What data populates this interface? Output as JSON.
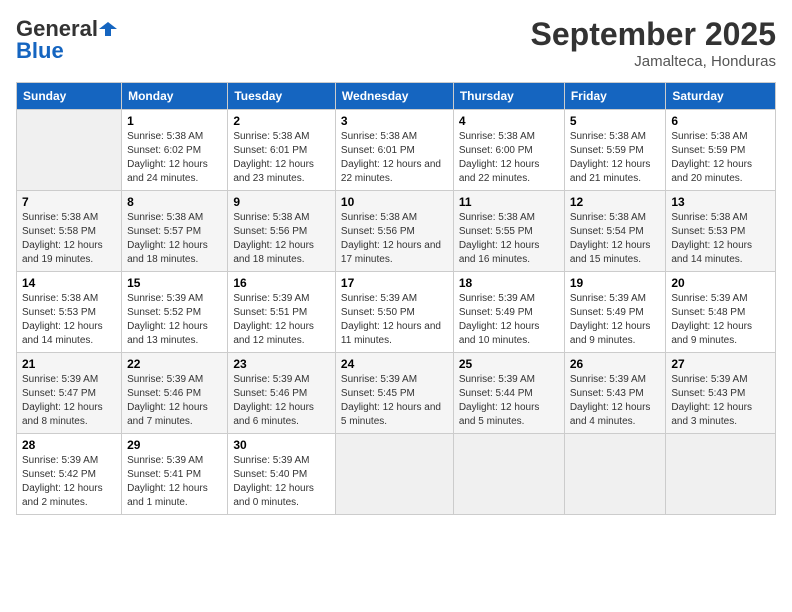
{
  "header": {
    "logo_general": "General",
    "logo_blue": "Blue",
    "month": "September 2025",
    "location": "Jamalteca, Honduras"
  },
  "days_of_week": [
    "Sunday",
    "Monday",
    "Tuesday",
    "Wednesday",
    "Thursday",
    "Friday",
    "Saturday"
  ],
  "weeks": [
    [
      {
        "day": "",
        "sunrise": "",
        "sunset": "",
        "daylight": ""
      },
      {
        "day": "1",
        "sunrise": "Sunrise: 5:38 AM",
        "sunset": "Sunset: 6:02 PM",
        "daylight": "Daylight: 12 hours and 24 minutes."
      },
      {
        "day": "2",
        "sunrise": "Sunrise: 5:38 AM",
        "sunset": "Sunset: 6:01 PM",
        "daylight": "Daylight: 12 hours and 23 minutes."
      },
      {
        "day": "3",
        "sunrise": "Sunrise: 5:38 AM",
        "sunset": "Sunset: 6:01 PM",
        "daylight": "Daylight: 12 hours and 22 minutes."
      },
      {
        "day": "4",
        "sunrise": "Sunrise: 5:38 AM",
        "sunset": "Sunset: 6:00 PM",
        "daylight": "Daylight: 12 hours and 22 minutes."
      },
      {
        "day": "5",
        "sunrise": "Sunrise: 5:38 AM",
        "sunset": "Sunset: 5:59 PM",
        "daylight": "Daylight: 12 hours and 21 minutes."
      },
      {
        "day": "6",
        "sunrise": "Sunrise: 5:38 AM",
        "sunset": "Sunset: 5:59 PM",
        "daylight": "Daylight: 12 hours and 20 minutes."
      }
    ],
    [
      {
        "day": "7",
        "sunrise": "Sunrise: 5:38 AM",
        "sunset": "Sunset: 5:58 PM",
        "daylight": "Daylight: 12 hours and 19 minutes."
      },
      {
        "day": "8",
        "sunrise": "Sunrise: 5:38 AM",
        "sunset": "Sunset: 5:57 PM",
        "daylight": "Daylight: 12 hours and 18 minutes."
      },
      {
        "day": "9",
        "sunrise": "Sunrise: 5:38 AM",
        "sunset": "Sunset: 5:56 PM",
        "daylight": "Daylight: 12 hours and 18 minutes."
      },
      {
        "day": "10",
        "sunrise": "Sunrise: 5:38 AM",
        "sunset": "Sunset: 5:56 PM",
        "daylight": "Daylight: 12 hours and 17 minutes."
      },
      {
        "day": "11",
        "sunrise": "Sunrise: 5:38 AM",
        "sunset": "Sunset: 5:55 PM",
        "daylight": "Daylight: 12 hours and 16 minutes."
      },
      {
        "day": "12",
        "sunrise": "Sunrise: 5:38 AM",
        "sunset": "Sunset: 5:54 PM",
        "daylight": "Daylight: 12 hours and 15 minutes."
      },
      {
        "day": "13",
        "sunrise": "Sunrise: 5:38 AM",
        "sunset": "Sunset: 5:53 PM",
        "daylight": "Daylight: 12 hours and 14 minutes."
      }
    ],
    [
      {
        "day": "14",
        "sunrise": "Sunrise: 5:38 AM",
        "sunset": "Sunset: 5:53 PM",
        "daylight": "Daylight: 12 hours and 14 minutes."
      },
      {
        "day": "15",
        "sunrise": "Sunrise: 5:39 AM",
        "sunset": "Sunset: 5:52 PM",
        "daylight": "Daylight: 12 hours and 13 minutes."
      },
      {
        "day": "16",
        "sunrise": "Sunrise: 5:39 AM",
        "sunset": "Sunset: 5:51 PM",
        "daylight": "Daylight: 12 hours and 12 minutes."
      },
      {
        "day": "17",
        "sunrise": "Sunrise: 5:39 AM",
        "sunset": "Sunset: 5:50 PM",
        "daylight": "Daylight: 12 hours and 11 minutes."
      },
      {
        "day": "18",
        "sunrise": "Sunrise: 5:39 AM",
        "sunset": "Sunset: 5:49 PM",
        "daylight": "Daylight: 12 hours and 10 minutes."
      },
      {
        "day": "19",
        "sunrise": "Sunrise: 5:39 AM",
        "sunset": "Sunset: 5:49 PM",
        "daylight": "Daylight: 12 hours and 9 minutes."
      },
      {
        "day": "20",
        "sunrise": "Sunrise: 5:39 AM",
        "sunset": "Sunset: 5:48 PM",
        "daylight": "Daylight: 12 hours and 9 minutes."
      }
    ],
    [
      {
        "day": "21",
        "sunrise": "Sunrise: 5:39 AM",
        "sunset": "Sunset: 5:47 PM",
        "daylight": "Daylight: 12 hours and 8 minutes."
      },
      {
        "day": "22",
        "sunrise": "Sunrise: 5:39 AM",
        "sunset": "Sunset: 5:46 PM",
        "daylight": "Daylight: 12 hours and 7 minutes."
      },
      {
        "day": "23",
        "sunrise": "Sunrise: 5:39 AM",
        "sunset": "Sunset: 5:46 PM",
        "daylight": "Daylight: 12 hours and 6 minutes."
      },
      {
        "day": "24",
        "sunrise": "Sunrise: 5:39 AM",
        "sunset": "Sunset: 5:45 PM",
        "daylight": "Daylight: 12 hours and 5 minutes."
      },
      {
        "day": "25",
        "sunrise": "Sunrise: 5:39 AM",
        "sunset": "Sunset: 5:44 PM",
        "daylight": "Daylight: 12 hours and 5 minutes."
      },
      {
        "day": "26",
        "sunrise": "Sunrise: 5:39 AM",
        "sunset": "Sunset: 5:43 PM",
        "daylight": "Daylight: 12 hours and 4 minutes."
      },
      {
        "day": "27",
        "sunrise": "Sunrise: 5:39 AM",
        "sunset": "Sunset: 5:43 PM",
        "daylight": "Daylight: 12 hours and 3 minutes."
      }
    ],
    [
      {
        "day": "28",
        "sunrise": "Sunrise: 5:39 AM",
        "sunset": "Sunset: 5:42 PM",
        "daylight": "Daylight: 12 hours and 2 minutes."
      },
      {
        "day": "29",
        "sunrise": "Sunrise: 5:39 AM",
        "sunset": "Sunset: 5:41 PM",
        "daylight": "Daylight: 12 hours and 1 minute."
      },
      {
        "day": "30",
        "sunrise": "Sunrise: 5:39 AM",
        "sunset": "Sunset: 5:40 PM",
        "daylight": "Daylight: 12 hours and 0 minutes."
      },
      {
        "day": "",
        "sunrise": "",
        "sunset": "",
        "daylight": ""
      },
      {
        "day": "",
        "sunrise": "",
        "sunset": "",
        "daylight": ""
      },
      {
        "day": "",
        "sunrise": "",
        "sunset": "",
        "daylight": ""
      },
      {
        "day": "",
        "sunrise": "",
        "sunset": "",
        "daylight": ""
      }
    ]
  ]
}
